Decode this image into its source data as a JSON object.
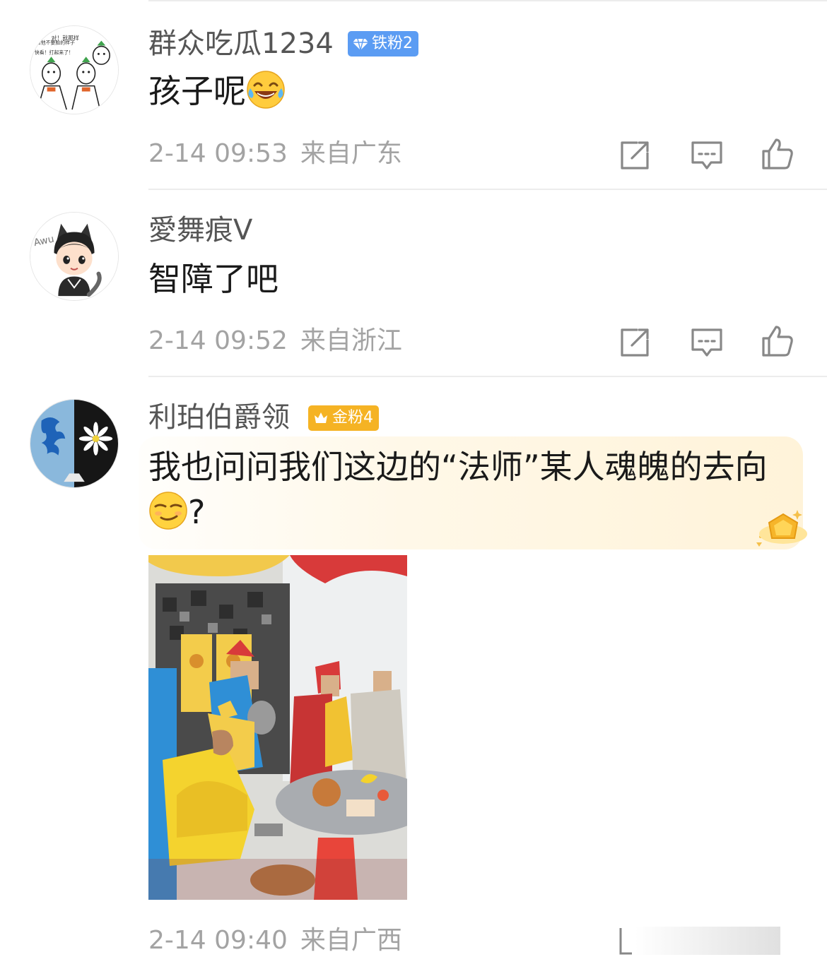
{
  "comments": [
    {
      "username": "群众吃瓜1234",
      "badge": {
        "label": "铁粉2",
        "icon": "diamond-icon",
        "color": "#5b9cf3"
      },
      "text": "孩子呢",
      "emoji": "laugh-cry-emoji",
      "time": "2-14 09:53",
      "location": "来自广东",
      "avatar_caption_1": "对！就那样",
      "avatar_caption_2": "给他不要脸的样子",
      "avatar_caption_3": "快看！打起来了！"
    },
    {
      "username": "愛舞痕V",
      "text": "智障了吧",
      "time": "2-14 09:52",
      "location": "来自浙江",
      "avatar_caption_1": "Awu"
    },
    {
      "username": "利珀伯爵领",
      "badge": {
        "label": "金粉4",
        "icon": "crown-icon",
        "color": "#f5b324"
      },
      "text_line1": "我也问问我们这边的“法师”某人魂魄的去向",
      "text_line2": "?",
      "emoji": "smirk-emoji",
      "time": "2-14 09:40",
      "location": "来自广西",
      "has_photo": true
    }
  ],
  "icons": {
    "share": "share-icon",
    "reply": "reply-icon",
    "like": "thumbs-up-icon"
  },
  "colors": {
    "iron_fan": "#5b9cf3",
    "gold_fan": "#f5b324",
    "meta_text": "#a3a3a3",
    "highlight_bg": "#fff3d9"
  }
}
